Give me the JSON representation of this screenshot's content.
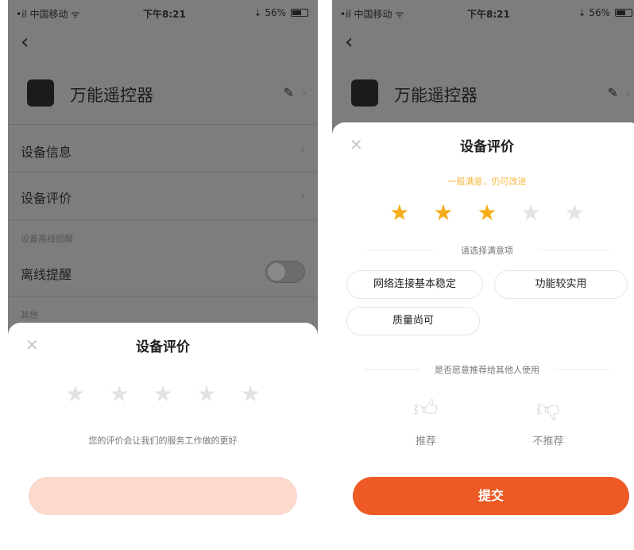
{
  "left": {
    "status": {
      "carrier": "•il 中国移动 ᯤ",
      "time": "下午8:21",
      "battery_pct": "⇣ 56%"
    },
    "device_name": "万能遥控器",
    "menu": {
      "device_info": "设备信息",
      "device_review": "设备评价",
      "offline_section": "设备离线提醒",
      "offline_reminder": "离线提醒",
      "other_section": "其他"
    },
    "sheet": {
      "title": "设备评价",
      "hint": "您的评价会让我们的服务工作做的更好",
      "stars_rating": 0,
      "stars_total": 5
    }
  },
  "right": {
    "status": {
      "carrier": "•il 中国移动 ᯤ",
      "time": "下午8:21",
      "battery_pct": "⇣ 56%"
    },
    "device_name": "万能遥控器",
    "sheet": {
      "title": "设备评价",
      "rating_message": "一般满意，仍可改进",
      "stars_rating": 3,
      "stars_total": 5,
      "satisfaction_prompt": "请选择满意项",
      "chips": [
        "网络连接基本稳定",
        "功能较实用",
        "质量尚可"
      ],
      "recommend_prompt": "是否愿意推荐给其他人使用",
      "recommend_label": "推荐",
      "not_recommend_label": "不推荐",
      "submit_label": "提交"
    }
  },
  "colors": {
    "accent": "#ed5a25",
    "star_on": "#f6ad1b",
    "star_off": "#e3e3e3",
    "dim_bg": "#7d7d7d"
  },
  "icons": {
    "back": "chevron-left-icon",
    "edit": "pencil-icon",
    "close": "close-icon",
    "star": "star-icon",
    "thumbs_up": "thumbs-up-icon",
    "thumbs_down": "thumbs-down-icon"
  }
}
